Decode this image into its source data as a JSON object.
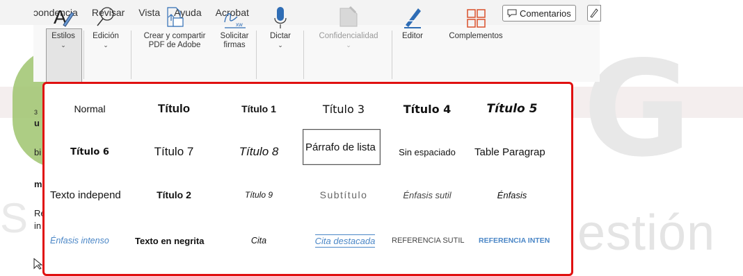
{
  "tabs": [
    "ɔondencia",
    "Revisar",
    "Vista",
    "Ayuda",
    "Acrobat"
  ],
  "comments_label": "Comentarios",
  "ribbon": {
    "estilos": "Estilos",
    "edicion": "Edición",
    "crear_line1": "Crear y compartir",
    "crear_line2": "PDF de Adobe",
    "solicitar_line1": "Solicitar",
    "solicitar_line2": "firmas",
    "dictar": "Dictar",
    "confidencialidad": "Confidencialidad",
    "editor": "Editor",
    "complementos": "Complementos"
  },
  "styles_gallery": [
    [
      "Normal",
      "Título",
      "Título 1",
      "Título 3",
      "Título 4",
      "Título 5"
    ],
    [
      "Título 6",
      "Título 7",
      "Título 8",
      "Párrafo de lista",
      "Sin espaciado",
      "Table Paragrap"
    ],
    [
      "Texto independ",
      "Título 2",
      "Título 9",
      "Subtítulo",
      "Énfasis sutil",
      "Énfasis"
    ],
    [
      "Énfasis intenso",
      "Texto en negrita",
      "Cita",
      "Cita destacada",
      "REFERENCIA SUTIL",
      "REFERENCIA INTEN"
    ]
  ],
  "selected_style": "Párrafo de lista",
  "background_letters": [
    "3",
    "u",
    "bi",
    "m",
    "Re",
    "in"
  ],
  "watermark": {
    "left": "S",
    "right": "estión",
    "logo": "G"
  },
  "colors": {
    "highlight_border": "#e01010",
    "accent_blue": "#2e74b5",
    "watermark_green": "#9fc46f"
  }
}
